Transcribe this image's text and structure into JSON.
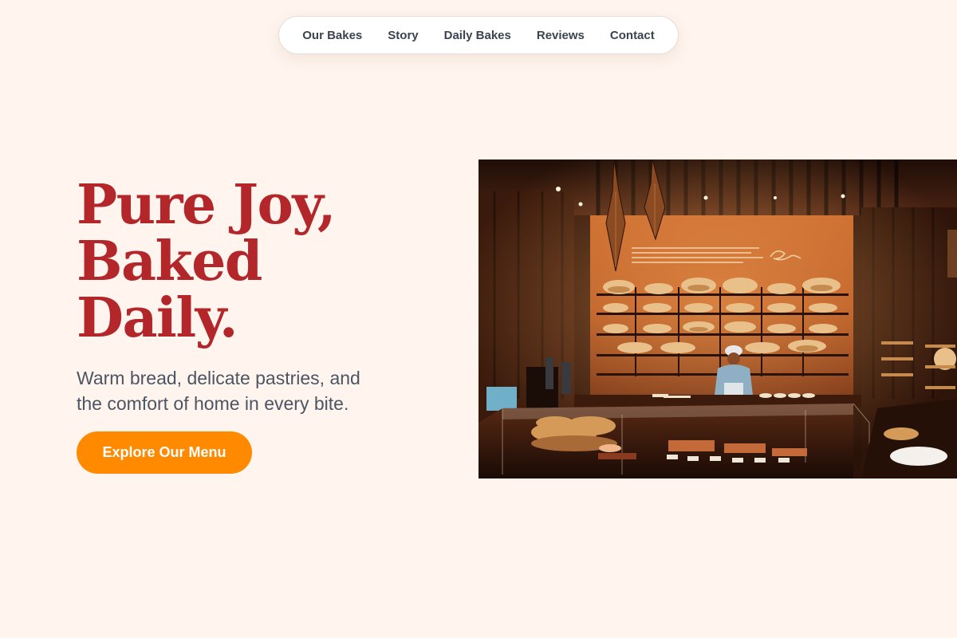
{
  "nav": {
    "links": [
      "Our Bakes",
      "Story",
      "Daily Bakes",
      "Reviews",
      "Contact"
    ]
  },
  "hero": {
    "title_lines": [
      "Pure Joy,",
      "Baked",
      "Daily."
    ],
    "subtitle_lines": [
      "Warm bread, delicate pastries, and",
      "the comfort of home in every bite."
    ],
    "cta_label": "Explore Our Menu"
  },
  "colors": {
    "background": "#fff5ee",
    "title": "#b3262a",
    "cta": "#ff8a00",
    "nav_text": "#3b4350",
    "body_text": "#4b5563"
  }
}
